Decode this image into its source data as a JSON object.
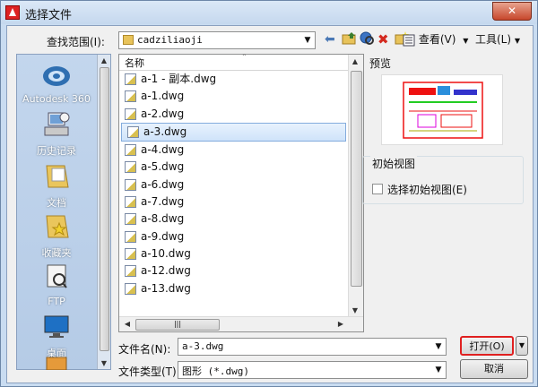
{
  "titlebar": {
    "title": "选择文件",
    "close_label": "✕"
  },
  "toolbar": {
    "lookin_label": "查找范围(I):",
    "lookin_value": "cadziliaoji",
    "views_label": "查看(V)",
    "tools_label": "工具(L)"
  },
  "places": [
    {
      "label": "Autodesk 360",
      "icon": "cloud-icon"
    },
    {
      "label": "历史记录",
      "icon": "history-icon"
    },
    {
      "label": "文档",
      "icon": "documents-icon"
    },
    {
      "label": "收藏夹",
      "icon": "favorites-icon"
    },
    {
      "label": "FTP",
      "icon": "ftp-icon"
    },
    {
      "label": "桌面",
      "icon": "desktop-icon"
    }
  ],
  "list": {
    "column_name": "名称",
    "files": [
      "a-1 - 副本.dwg",
      "a-1.dwg",
      "a-2.dwg",
      "a-3.dwg",
      "a-4.dwg",
      "a-5.dwg",
      "a-6.dwg",
      "a-7.dwg",
      "a-8.dwg",
      "a-9.dwg",
      "a-10.dwg",
      "a-12.dwg",
      "a-13.dwg"
    ],
    "selected": "a-3.dwg"
  },
  "preview": {
    "label": "预览"
  },
  "initial_view": {
    "group_label": "初始视图",
    "checkbox_label": "选择初始视图(E)",
    "checked": false
  },
  "filename": {
    "label": "文件名(N):",
    "value": "a-3.dwg"
  },
  "filetype": {
    "label": "文件类型(T):",
    "value": "图形 (*.dwg)"
  },
  "buttons": {
    "open": "打开(O)",
    "cancel": "取消"
  },
  "colors": {
    "accent_red": "#e02020",
    "selection": "#cfe3fa"
  }
}
